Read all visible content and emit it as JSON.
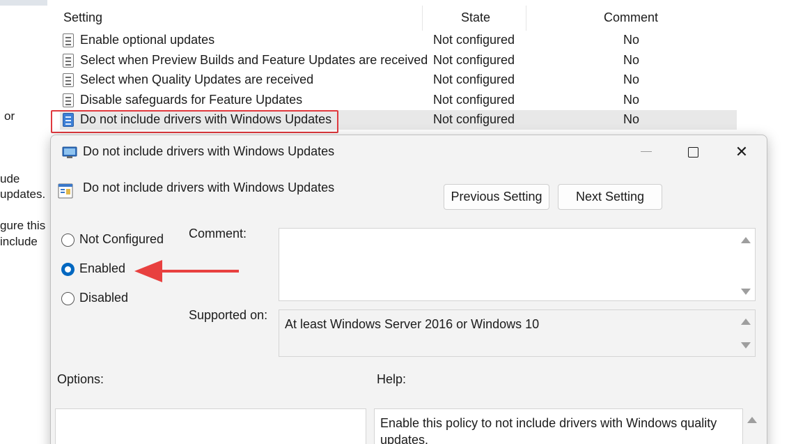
{
  "background": {
    "side_text": [
      "or",
      "ude",
      "updates.",
      "gure this",
      "include"
    ],
    "columns": {
      "setting": "Setting",
      "state": "State",
      "comment": "Comment"
    },
    "rows": [
      {
        "name": "Enable optional updates",
        "state": "Not configured",
        "comment": "No"
      },
      {
        "name": "Select when Preview Builds and Feature Updates are received",
        "state": "Not configured",
        "comment": "No"
      },
      {
        "name": "Select when Quality Updates are received",
        "state": "Not configured",
        "comment": "No"
      },
      {
        "name": "Disable safeguards for Feature Updates",
        "state": "Not configured",
        "comment": "No"
      },
      {
        "name": "Do not include drivers with Windows Updates",
        "state": "Not configured",
        "comment": "No",
        "selected": true
      }
    ]
  },
  "dialog": {
    "title": "Do not include drivers with Windows Updates",
    "header": "Do not include drivers with Windows Updates",
    "close_glyph": "✕",
    "buttons": {
      "previous": "Previous Setting",
      "next": "Next Setting"
    },
    "radios": [
      {
        "label": "Not Configured",
        "checked": false
      },
      {
        "label": "Enabled",
        "checked": true
      },
      {
        "label": "Disabled",
        "checked": false
      }
    ],
    "comment_label": "Comment:",
    "comment_value": "",
    "supported_label": "Supported on:",
    "supported_value": "At least Windows Server 2016 or Windows 10",
    "options_label": "Options:",
    "help_label": "Help:",
    "help_text": "Enable this policy to not include drivers with Windows quality updates."
  },
  "colors": {
    "highlight": "#e0393e",
    "arrow": "#e8403f",
    "radio_accent": "#0067c0"
  }
}
